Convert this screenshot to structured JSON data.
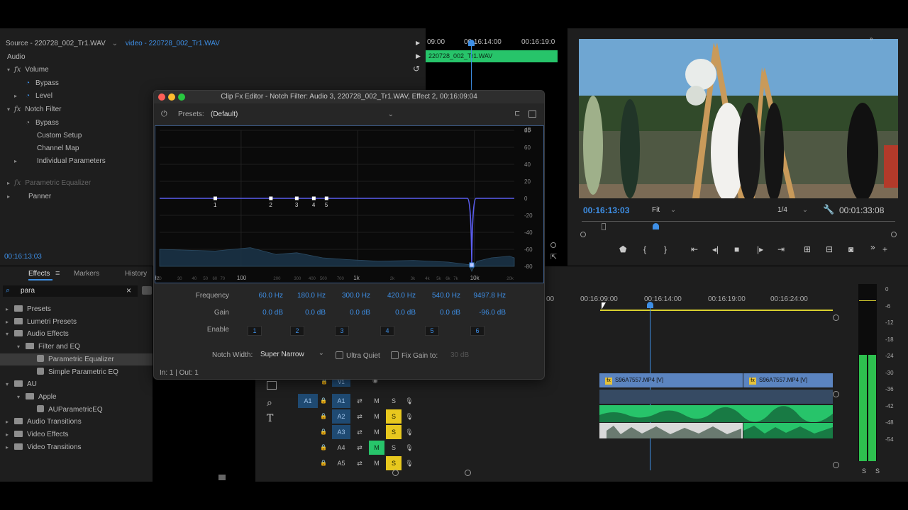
{
  "source": {
    "tab_source": "Source - 220728_002_Tr1.WAV",
    "tab_video": "video - 220728_002_Tr1.WAV",
    "section": "Audio",
    "volume": "Volume",
    "bypass": "Bypass",
    "level": "Level",
    "notch_filter": "Notch Filter",
    "bypass2": "Bypass",
    "custom_setup": "Custom Setup",
    "channel_map": "Channel Map",
    "individual_params": "Individual Parameters",
    "parametric_eq": "Parametric Equalizer",
    "panner": "Panner",
    "timecode": "00:16:13:03",
    "mini_tl_t1": "09:00",
    "mini_tl_t2": "00:16:14:00",
    "mini_tl_t3": "00:16:19:0",
    "mini_clip": "220728_002_Tr1.WAV"
  },
  "effects_panel": {
    "tab_effects": "Effects",
    "tab_markers": "Markers",
    "tab_history": "History",
    "search_value": "para",
    "tree": [
      {
        "label": "Presets",
        "kind": "folder",
        "indent": 0,
        "open": false
      },
      {
        "label": "Lumetri Presets",
        "kind": "folder",
        "indent": 0,
        "open": false
      },
      {
        "label": "Audio Effects",
        "kind": "folder",
        "indent": 0,
        "open": true
      },
      {
        "label": "Filter and EQ",
        "kind": "folder",
        "indent": 1,
        "open": true
      },
      {
        "label": "Parametric Equalizer",
        "kind": "preset",
        "indent": 2,
        "selected": true
      },
      {
        "label": "Simple Parametric EQ",
        "kind": "preset",
        "indent": 2
      },
      {
        "label": "AU",
        "kind": "folder",
        "indent": 0,
        "open": true
      },
      {
        "label": "Apple",
        "kind": "folder",
        "indent": 1,
        "open": true
      },
      {
        "label": "AUParametricEQ",
        "kind": "preset",
        "indent": 2
      },
      {
        "label": "Audio Transitions",
        "kind": "folder",
        "indent": 0,
        "open": false
      },
      {
        "label": "Video Effects",
        "kind": "folder",
        "indent": 0,
        "open": false
      },
      {
        "label": "Video Transitions",
        "kind": "folder",
        "indent": 0,
        "open": false
      }
    ]
  },
  "fx_editor": {
    "title": "Clip Fx Editor - Notch Filter: Audio 3, 220728_002_Tr1.WAV, Effect 2, 00:16:09:04",
    "presets_label": "Presets:",
    "presets_value": "(Default)",
    "db_label": "dB",
    "db_ticks": [
      "80",
      "60",
      "40",
      "20",
      "0",
      "-20",
      "-40",
      "-60",
      "-80"
    ],
    "hz_ticks": [
      "Hz",
      "20",
      "30",
      "40",
      "50",
      "60",
      "70",
      "100",
      "200",
      "300",
      "400",
      "500",
      "700",
      "1k",
      "2k",
      "3k",
      "4k",
      "5k",
      "6k",
      "7k",
      "10k",
      "20k"
    ],
    "node_labels": [
      "1",
      "2",
      "3",
      "4",
      "5"
    ],
    "rows": {
      "frequency_label": "Frequency",
      "gain_label": "Gain",
      "enable_label": "Enable",
      "frequencies": [
        "60.0 Hz",
        "180.0 Hz",
        "300.0 Hz",
        "420.0 Hz",
        "540.0 Hz",
        "9497.8 Hz"
      ],
      "gains": [
        "0.0 dB",
        "0.0 dB",
        "0.0 dB",
        "0.0 dB",
        "0.0 dB",
        "-96.0 dB"
      ],
      "enables": [
        "1",
        "2",
        "3",
        "4",
        "5",
        "6"
      ]
    },
    "notch_width_label": "Notch Width:",
    "notch_width_value": "Super Narrow",
    "ultra_quiet": "Ultra Quiet",
    "fix_gain": "Fix Gain to:",
    "fix_gain_value": "30 dB",
    "io": "In: 1 | Out: 1"
  },
  "program": {
    "timecode": "00:16:13:03",
    "fit": "Fit",
    "quality": "1/4",
    "duration": "00:01:33:08"
  },
  "timeline": {
    "ruler": [
      "00",
      "00:16:09:00",
      "00:16:14:00",
      "00:16:19:00",
      "00:16:24:00"
    ],
    "tracks": [
      {
        "src": "A1",
        "name": "A1",
        "m": "M",
        "s": "S",
        "m_on": false,
        "s_on": false
      },
      {
        "src": "",
        "name": "A2",
        "m": "M",
        "s": "S",
        "m_on": false,
        "s_on": true
      },
      {
        "src": "",
        "name": "A3",
        "m": "M",
        "s": "S",
        "m_on": false,
        "s_on": true
      },
      {
        "src": "",
        "name": "A4",
        "m": "M",
        "s": "S",
        "m_on": true,
        "s_on": false
      },
      {
        "src": "",
        "name": "A5",
        "m": "M",
        "s": "S",
        "m_on": false,
        "s_on": true
      }
    ],
    "v1_label": "V1",
    "clip1": "S96A7557.MP4 [V]",
    "clip2": "S96A7557.MP4 [V]"
  },
  "meter": {
    "ticks": [
      "0",
      "-6",
      "-12",
      "-18",
      "-24",
      "-30",
      "-36",
      "-42",
      "-48",
      "-54"
    ],
    "solo_left": "S",
    "solo_right": "S"
  },
  "colors": {
    "accent": "#3e8fe6",
    "clip_green": "#27c46a",
    "solo_yellow": "#e8c81e",
    "video_clip": "#5b84c0"
  }
}
